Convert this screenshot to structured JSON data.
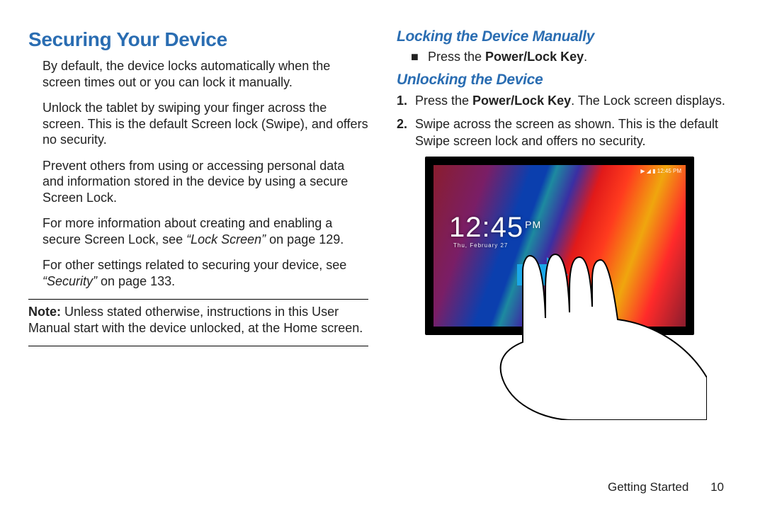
{
  "left": {
    "title": "Securing Your Device",
    "p1": "By default, the device locks automatically when the screen times out or you can lock it manually.",
    "p2": "Unlock the tablet by swiping your finger across the screen. This is the default Screen lock (Swipe), and offers no security.",
    "p3": "Prevent others from using or accessing personal data and information stored in the device by using a secure Screen Lock.",
    "p4a": "For more information about creating and enabling a secure Screen Lock, see ",
    "p4ref": "“Lock Screen”",
    "p4b": " on page 129.",
    "p5a": "For other settings related to securing your device, see ",
    "p5ref": "“Security”",
    "p5b": " on page 133.",
    "noteLabel": "Note: ",
    "noteText": "Unless stated otherwise, instructions in this User Manual start with the device unlocked, at the Home screen."
  },
  "right": {
    "h2a": "Locking the Device Manually",
    "bullet1a": "Press the ",
    "bullet1bold": "Power/Lock Key",
    "bullet1b": ".",
    "h2b": "Unlocking the Device",
    "step1a": "Press the ",
    "step1bold": "Power/Lock Key",
    "step1b": ". The Lock screen displays.",
    "step2": "Swipe across the screen as shown. This is the default Swipe screen lock and offers no security."
  },
  "tablet": {
    "time": "12:45",
    "ampm": "PM",
    "date": "Thu, February 27",
    "status": "▶ ◢ ▮ 12:45 PM"
  },
  "footer": {
    "section": "Getting Started",
    "page": "10"
  }
}
